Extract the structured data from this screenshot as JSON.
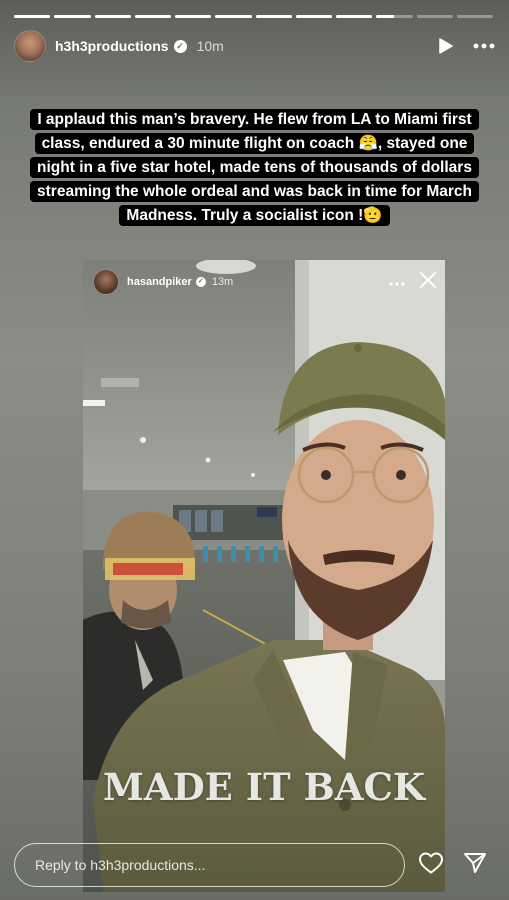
{
  "progress": {
    "segments": [
      1,
      1,
      1,
      1,
      1,
      1,
      1,
      1,
      1,
      0.5,
      0,
      0
    ],
    "colors": {
      "filled": "#ffffff",
      "empty": "rgba(255,255,255,0.35)"
    }
  },
  "header": {
    "username": "h3h3productions",
    "verified_icon": "verified-badge-icon",
    "time": "10m",
    "play_icon": "play-icon",
    "more_icon": "more-horizontal-icon"
  },
  "caption": {
    "text": "I applaud this man’s bravery. He flew from LA to Miami first class, endured a 30 minute flight on coach 😤, stayed one night in a five star hotel, made tens of thousands of dollars streaming the whole ordeal and was back in time for March Madness. Truly a socialist icon !🫡"
  },
  "inner_story": {
    "username": "hasandpiker",
    "time": "13m",
    "more_icon": "more-horizontal-icon",
    "close_icon": "close-icon",
    "overlay_text": "MADE IT BACK"
  },
  "reply": {
    "placeholder": "Reply to h3h3productions...",
    "like_icon": "heart-icon",
    "share_icon": "send-icon"
  }
}
